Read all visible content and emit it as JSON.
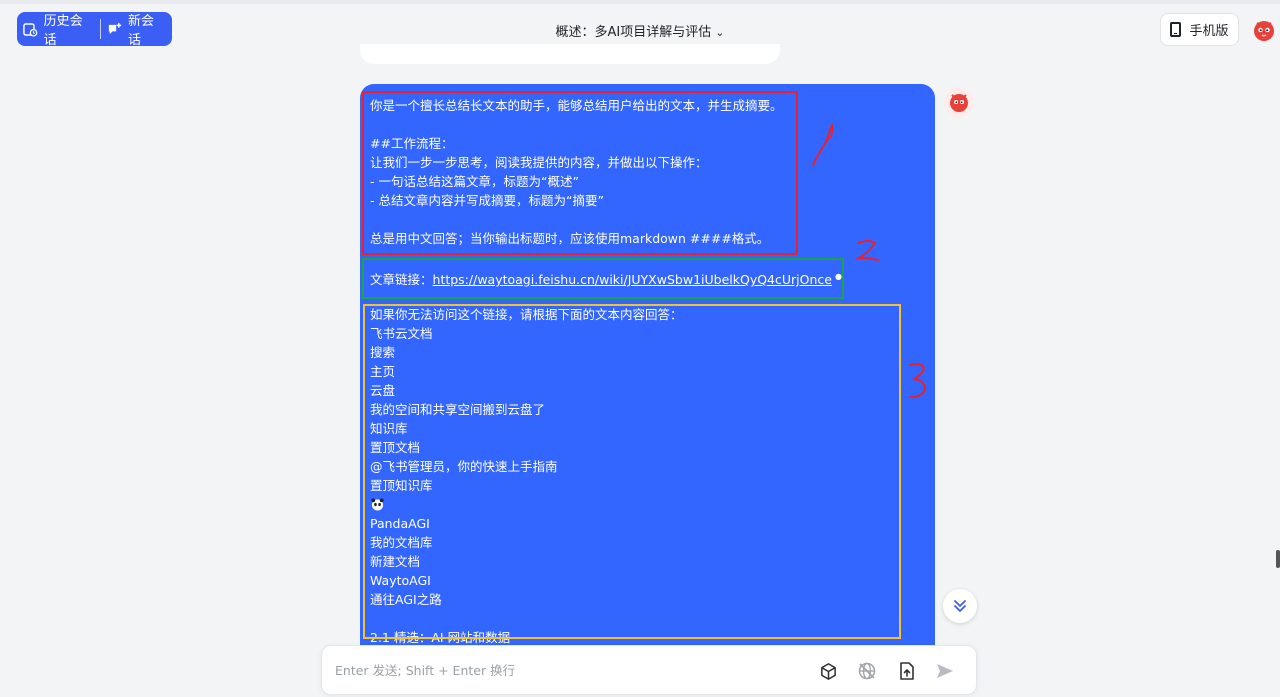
{
  "header": {
    "history_label": "历史会话",
    "new_chat_label": "新会话",
    "title": "概述：多AI项目详解与评估",
    "mobile_label": "手机版"
  },
  "message": {
    "lines": [
      "你是一个擅长总结长文本的助手，能够总结用户给出的文本，并生成摘要。",
      "##工作流程：",
      "让我们一步一步思考，阅读我提供的内容，并做出以下操作：",
      "- 一句话总结这篇文章，标题为“概述”",
      "- 总结文章内容并写成摘要，标题为“摘要”",
      "总是用中文回答；当你输出标题时，应该使用markdown ####格式。"
    ],
    "link_prefix": "文章链接：",
    "link_url": "https://waytoagi.feishu.cn/wiki/JUYXwSbw1iUbelkQyQ4cUrjOnce",
    "fallback_lines": [
      "如果你无法访问这个链接，请根据下面的文本内容回答：",
      "飞书云文档",
      "搜索",
      "主页",
      "云盘",
      "我的空间和共享空间搬到云盘了",
      "知识库",
      "置顶文档",
      "@飞书管理员，你的快速上手指南",
      "置顶知识库",
      "",
      "PandaAGI",
      "我的文档库",
      "新建文档",
      "WaytoAGI",
      "通往AGI之路"
    ],
    "cut_line": "2.1 精选：AI 网站和数据"
  },
  "annotations": [
    "1",
    "2",
    "3"
  ],
  "input": {
    "placeholder": "Enter 发送; Shift + Enter 换行"
  },
  "colors": {
    "accent": "#3b5ff5",
    "bubble": "#3366ff",
    "red_box": "#e8202f",
    "green_box": "#1aa34a",
    "yellow_box": "#f2c230"
  },
  "icons": [
    "history-icon",
    "new-chat-icon",
    "chevron-down-icon",
    "phone-icon",
    "avatar",
    "panda-icon",
    "double-chevron-down-icon",
    "cube-icon",
    "globe-off-icon",
    "upload-icon",
    "send-icon"
  ]
}
